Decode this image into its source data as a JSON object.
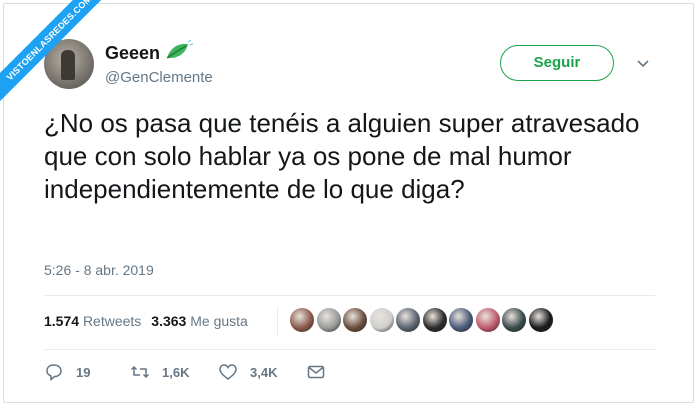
{
  "watermark": {
    "text": "VISTOENLASREDES.COM"
  },
  "author": {
    "display_name": "Geeen",
    "handle": "@GenClemente",
    "name_icon": "leaf-emoji-icon"
  },
  "follow_button": {
    "label": "Seguir"
  },
  "tweet": {
    "text": "¿No os pasa que tenéis a alguien super atravesado que con solo hablar ya os pone de mal humor independientemente de lo que diga?",
    "timestamp": "5:26 - 8 abr. 2019"
  },
  "stats": {
    "retweets_count": "1.574",
    "retweets_label": "Retweets",
    "likes_count": "3.363",
    "likes_label": "Me gusta"
  },
  "liker_avatars": [
    {
      "color": "#8a5a4a"
    },
    {
      "color": "#9a9a9a"
    },
    {
      "color": "#6b4d3d"
    },
    {
      "color": "#d0d0d0"
    },
    {
      "color": "#5a6470"
    },
    {
      "color": "#2a2a2a"
    },
    {
      "color": "#4a5a7a"
    },
    {
      "color": "#c05a6a"
    },
    {
      "color": "#3a4a4a"
    },
    {
      "color": "#1a1a1a"
    }
  ],
  "actions": {
    "reply_count": "19",
    "retweet_count": "1,6K",
    "like_count": "3,4K"
  },
  "colors": {
    "follow_green": "#1ba34b",
    "ribbon_blue": "#1da1f2",
    "muted": "#657786"
  }
}
